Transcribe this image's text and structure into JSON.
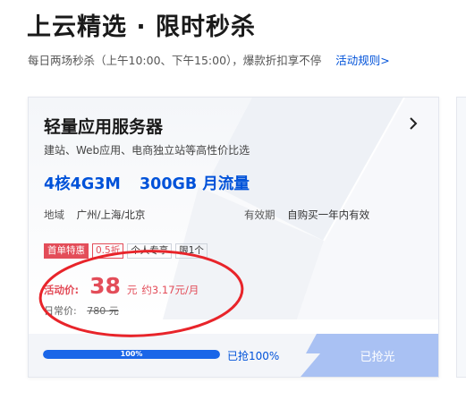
{
  "header": {
    "title": "上云精选 · 限时秒杀",
    "subtitle": "每日两场秒杀（上午10:00、下午15:00），爆款折扣享不停",
    "rules_link": "活动规则>"
  },
  "card": {
    "title": "轻量应用服务器",
    "description": "建站、Web应用、电商独立站等高性价比选",
    "spec_config": "4核4G3M",
    "spec_traffic": "300GB 月流量",
    "region_label": "地域",
    "region_value": "广州/上海/北京",
    "validity_label": "有效期",
    "validity_value": "自购买一年内有效",
    "tags": [
      "首单特惠",
      "0.5折",
      "个人专享",
      "限1个"
    ],
    "price_label": "活动价:",
    "price_value": "38",
    "price_unit": "元",
    "price_monthly": "约3.17元/月",
    "original_label": "日常价:",
    "original_price": "780 元",
    "progress_label": "100%",
    "progress_fraction": 1.0,
    "grabbed_text": "已抢100%",
    "soldout_button": "已抢光"
  },
  "colors": {
    "accent_blue": "#0052d9",
    "price_red": "#e34d59",
    "annotation_red": "#e8242a"
  }
}
